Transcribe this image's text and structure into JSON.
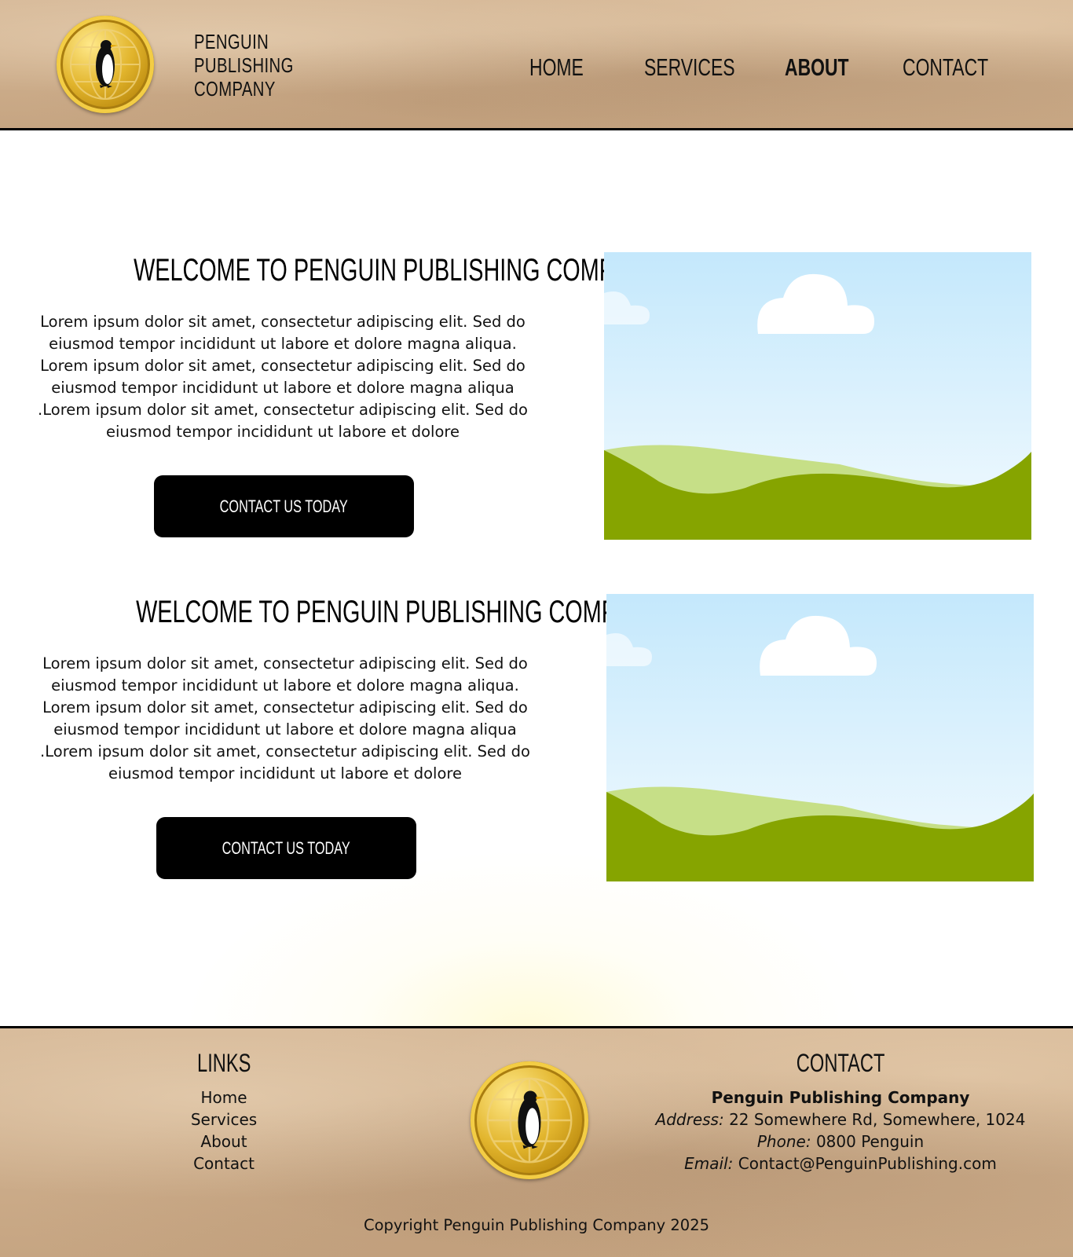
{
  "header": {
    "brand_lines": [
      "PENGUIN",
      "PUBLISHING",
      "COMPANY"
    ],
    "logo_icon": "penguin-globe-icon",
    "nav": [
      {
        "label": "HOME",
        "active": false
      },
      {
        "label": "SERVICES",
        "active": false
      },
      {
        "label": "ABOUT",
        "active": true
      },
      {
        "label": "CONTACT",
        "active": false
      }
    ]
  },
  "sections": [
    {
      "title": "WELCOME TO PENGUIN PUBLISHING COMPANY",
      "body": "Lorem ipsum dolor sit amet, consectetur adipiscing elit. Sed do eiusmod tempor incididunt ut labore et dolore magna aliqua. Lorem ipsum dolor sit amet, consectetur adipiscing elit. Sed do eiusmod tempor incididunt ut labore et dolore magna aliqua .Lorem ipsum dolor sit amet, consectetur adipiscing elit. Sed do eiusmod tempor incididunt ut labore et dolore",
      "cta_label": "CONTACT US TODAY",
      "image_icon": "landscape-illustration"
    },
    {
      "title": "WELCOME TO PENGUIN PUBLISHING COMPANY",
      "body": "Lorem ipsum dolor sit amet, consectetur adipiscing elit. Sed do eiusmod tempor incididunt ut labore et dolore magna aliqua. Lorem ipsum dolor sit amet, consectetur adipiscing elit. Sed do eiusmod tempor incididunt ut labore et dolore magna aliqua .Lorem ipsum dolor sit amet, consectetur adipiscing elit. Sed do eiusmod tempor incididunt ut labore et dolore",
      "cta_label": "CONTACT US TODAY",
      "image_icon": "landscape-illustration"
    }
  ],
  "footer": {
    "links_title": "LINKS",
    "links": [
      "Home",
      "Services",
      "About",
      "Contact"
    ],
    "contact_title": "CONTACT",
    "company": "Penguin Publishing Company",
    "address_label": "Address:",
    "address": "22 Somewhere Rd, Somewhere, 1024",
    "phone_label": "Phone:",
    "phone": "0800 Penguin",
    "email_label": "Email:",
    "email": "Contact@PenguinPublishing.com",
    "copyright": "Copyright Penguin Publishing Company 2025"
  },
  "colors": {
    "paper": "#c9a98a",
    "sky_top": "#c4e8fc",
    "sky_bottom": "#f2fafe",
    "hill_light": "#c6df87",
    "hill_dark": "#86a400",
    "button": "#000000",
    "gold": "#e2b52d"
  }
}
